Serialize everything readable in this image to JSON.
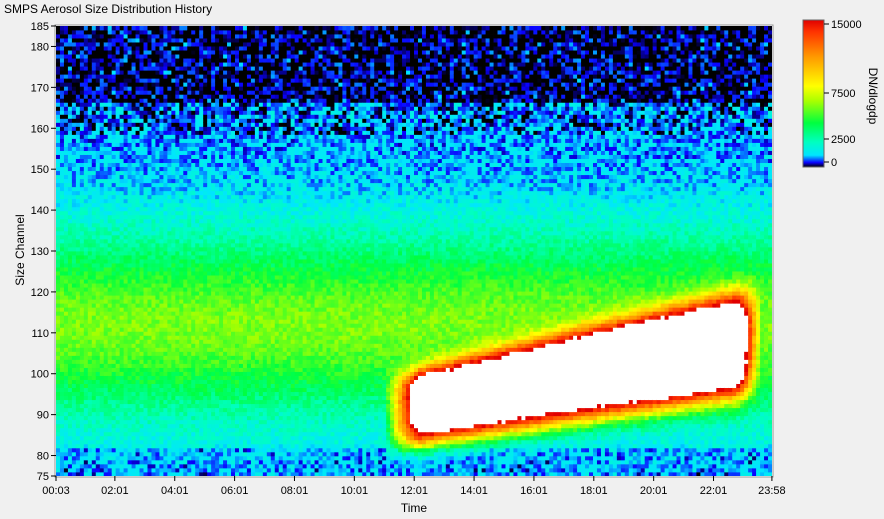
{
  "window": {
    "title": "SMPS Aerosol Size Distribution History"
  },
  "chart_data": {
    "type": "heatmap",
    "title": "SMPS Aerosol Size Distribution History",
    "xlabel": "Time",
    "ylabel": "Size Channel",
    "x_ticks": [
      "00:03",
      "02:01",
      "04:01",
      "06:01",
      "08:01",
      "10:01",
      "12:01",
      "14:01",
      "16:01",
      "18:01",
      "20:01",
      "22:01",
      "23:58"
    ],
    "y_ticks": [
      75,
      80,
      90,
      100,
      110,
      120,
      130,
      140,
      150,
      160,
      170,
      180,
      185
    ],
    "y_range": [
      75,
      185
    ],
    "x_range_hours": [
      0.05,
      23.97
    ],
    "colorbar": {
      "label": "DN/dlogdp",
      "ticks": [
        0,
        2500,
        7500,
        15000
      ],
      "tick_labels": [
        "0",
        "2500",
        "7500",
        "15000"
      ],
      "range": [
        0,
        15000
      ]
    },
    "features": [
      {
        "name": "main-growth-mode",
        "start_time": "11:00",
        "end_time": "23:30",
        "channel_low": 85,
        "channel_high": 120,
        "peak": 15000
      },
      {
        "name": "background-mode",
        "channels": [
          100,
          130
        ],
        "value": 5000
      },
      {
        "name": "upper-noise-band",
        "channels": [
          160,
          185
        ],
        "value": 0
      }
    ]
  }
}
